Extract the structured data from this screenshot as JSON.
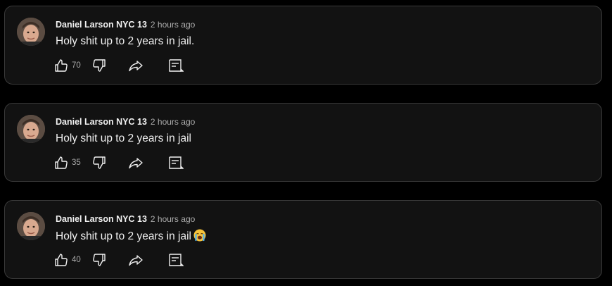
{
  "comments": [
    {
      "author": "Daniel Larson NYC 13",
      "time": "2 hours ago",
      "text": "Holy shit up to 2 years in jail.",
      "emoji": "",
      "likes": "70"
    },
    {
      "author": "Daniel Larson NYC 13",
      "time": "2 hours ago",
      "text": "Holy shit up to 2 years in jail",
      "emoji": "",
      "likes": "35"
    },
    {
      "author": "Daniel Larson NYC 13",
      "time": "2 hours ago",
      "text": "Holy shit up to 2 years in jail",
      "emoji": "loudly-crying-face",
      "likes": "40"
    }
  ],
  "icons": {
    "like": "thumbs-up-icon",
    "dislike": "thumbs-down-icon",
    "share": "share-arrow-icon",
    "reply": "reply-comment-icon"
  },
  "colors": {
    "background": "#000000",
    "card": "#121212",
    "card_border": "#3a3a3a",
    "text": "#f1f1f1",
    "secondary_text": "#aaaaaa"
  }
}
